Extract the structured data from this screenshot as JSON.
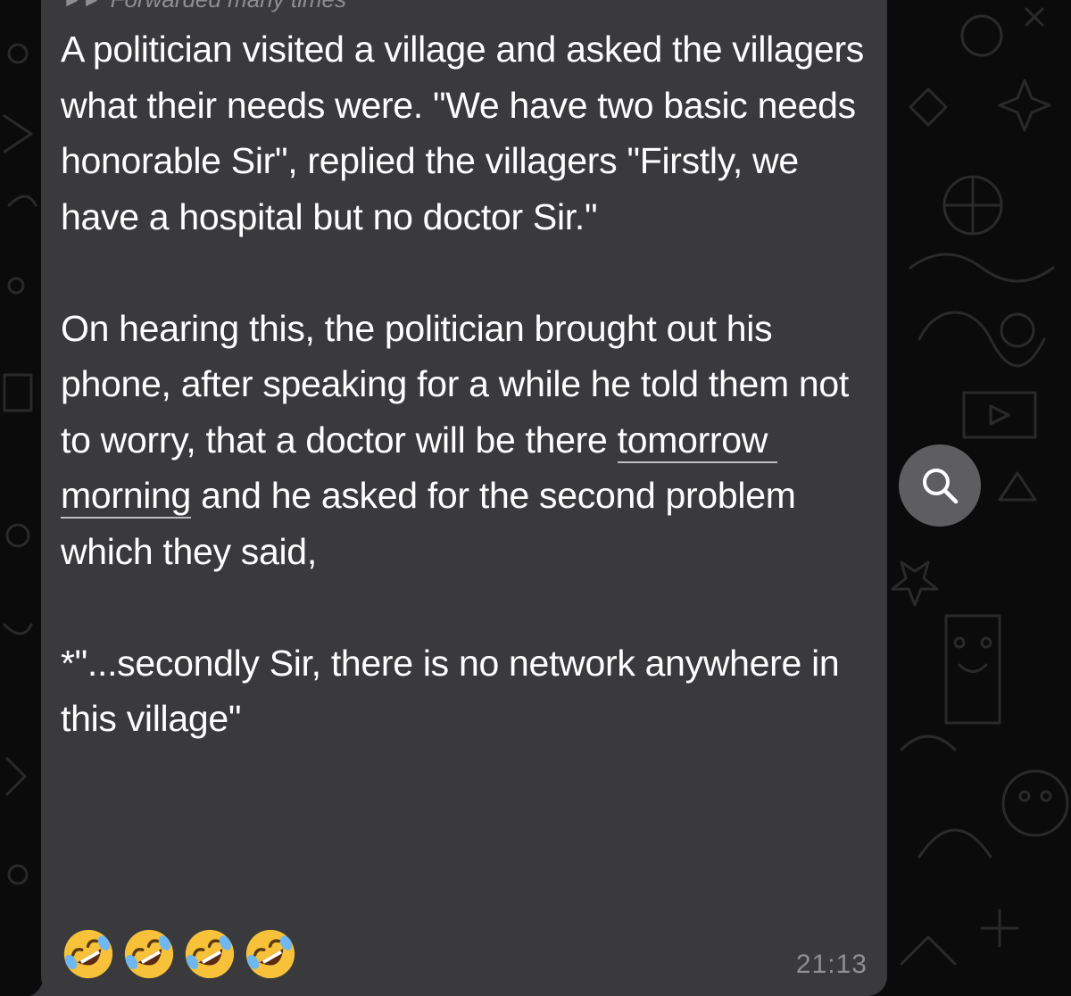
{
  "message": {
    "forwarded_label": "Forwarded many times",
    "paragraphs": {
      "p1": "A politician visited a village and asked the villagers what their needs were. \"We have two basic needs honorable Sir\", replied the villagers \"Firstly, we have a hospital but no doctor Sir.\"",
      "p2_before": "On hearing this, the politician brought out his phone, after speaking for a while he told them not to worry, that a doctor will be there ",
      "p2_link": "tomorrow morning",
      "p2_after": " and he asked for the second problem which they said,",
      "p3": "*\"...secondly Sir, there is no network anywhere in this village\""
    },
    "emojis": [
      "rolling-on-floor-laughing",
      "rolling-on-floor-laughing",
      "rolling-on-floor-laughing",
      "rolling-on-floor-laughing"
    ],
    "time": "21:13"
  },
  "icons": {
    "search": "search-icon",
    "forward": "forward-icon"
  },
  "colors": {
    "background": "#0b0b0b",
    "bubble": "#3a3a3c",
    "text": "#ffffff",
    "muted": "#8e8e93",
    "search_button": "#5e5e60"
  }
}
